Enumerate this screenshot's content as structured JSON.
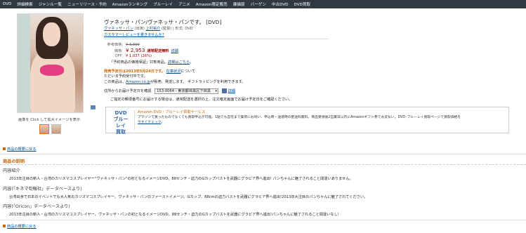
{
  "topnav": [
    "DVD",
    "詳細検索",
    "ジャンル一覧",
    "ニューリリース・予約",
    "Amazonランキング",
    "ブルーレイ",
    "アニメ",
    "Amazon限定販売",
    "廉価版",
    "バーゲン",
    "中古DVD",
    "DVD買取"
  ],
  "product": {
    "title": "ヴァネッサ・パン/ヴァネッサ・パンです。 [DVD]",
    "artist_link": "ヴァネッサ・パン",
    "artist_role": "(出演)",
    "director_link": "上村祐介",
    "director_role": "(監督)",
    "format": "| 形式: DVD",
    "review_link": "カスタマーレビューを書きませんか?"
  },
  "price": {
    "list_label": "参考価格:",
    "list_value": "¥ 3,990",
    "price_label": "価格:",
    "price_value": "¥ 2,953",
    "shipping": "通常配送無料",
    "details": "詳細",
    "off_label": "OFF:",
    "off_value": "¥ 1,037 (26%)",
    "guarantee_prefix": "「予約商品の価格保証」対象商品。",
    "guarantee_link": "詳細はこちら",
    "guarantee_suffix": "。"
  },
  "release": {
    "date_text": "発売予定日は2013年5月24日です。",
    "stock_link": "在庫状況",
    "stock_suffix": "について",
    "order_text": "ただいま予約受付中です。",
    "seller_prefix": "この商品は、",
    "seller_link": "Amazon.co.jp",
    "seller_suffix": "が販売、発送します。 ギフトラッピングを利用できます。"
  },
  "delivery": {
    "label": "住所からお届け予定日を確認",
    "select_value": "153-0064 - 東京都目黒区下目黒",
    "details": "詳細",
    "note": "ご指定の郵便番号にお届けする場合は、通常配送を選択の上、注文確定画面でお届け予定日をご確認ください。"
  },
  "image": {
    "caption": "画像を Click して拡大イメージを表示"
  },
  "dvd_buy": {
    "logo_line1": "DVD",
    "logo_line2": "ブルーレイ",
    "logo_line3": "買取",
    "heading": "Amazon DVD・ブルーレイ買取サービス",
    "desc": "アマゾンで買ったものでなくても買取申込が可能。1點でも自宅まで集荷にお伺い、申込時・送達時の配送料無料。商品受領後2営業日以内にAmazonギフト券でお支払い。DVD･ブルーレイ買取ページで買取価格を",
    "check_link": "今すぐチェック",
    "check_suffix": "。"
  },
  "back_link": "商品の概要に戻る",
  "description": {
    "title": "商品の説明",
    "section1_title": "内容紹介",
    "section1_text": "2013年注目の新人・台湾のカリスマコスプレイヤー\"ヴァネッサ・パン\"の初となるイメージDVD。88センチ・迫力のGカップバストを武器にグラビア界へ進出! パンちゃんに魅了されること間違いありません。",
    "section2_title": "内容(「キネマ旬報社」データベースより)",
    "section2_text": "台湾出身で日本のイベントでも大人気のカリスマコスプレイヤー、ヴァネッサ・パンのファーストイメージ。Gカップ、88cmの迫力バストを武器にグラビア界へ進出!2013年大注目のパンちゃんに魅了されてください。",
    "section3_title": "内容(「Oricon」データベースより)",
    "section3_text": "2013年注目の新人・台湾のカリスマコスプレイヤー、ヴァネッサ・パンの初となるイメージDVD。88センチ・迫力のGカップバストを武器にグラビア界へ進出!パンちゃんに魅了されること間違いなし!"
  },
  "back_link_bottom": "商品の概要に戻る"
}
